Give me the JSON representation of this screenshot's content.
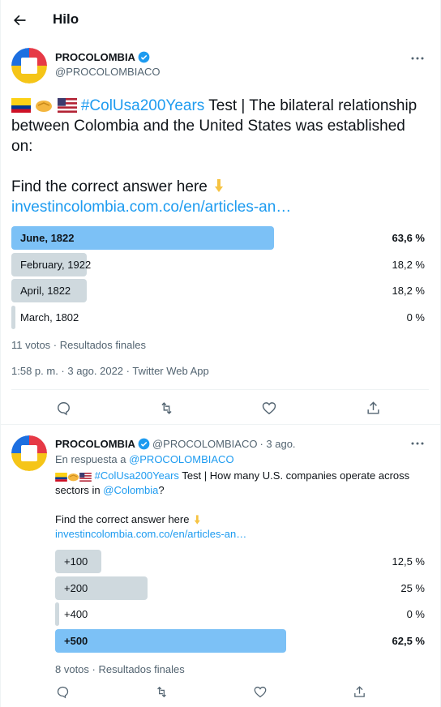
{
  "header": {
    "title": "Hilo",
    "back_icon": "arrow-left-icon"
  },
  "colors": {
    "accent": "#1d9bf0",
    "poll_winner": "#7cc1f6",
    "poll_other": "#cfd9de",
    "muted": "#536471",
    "verified": "#1d9bf0"
  },
  "tweet1": {
    "name": "PROCOLOMBIA",
    "handle": "@PROCOLOMBIACO",
    "verified_icon": "verified-badge-icon",
    "more_icon": "more-horizontal-icon",
    "emojis": [
      "colombia-flag-icon",
      "handshake-icon",
      "usa-flag-icon"
    ],
    "hashtag": "#ColUsa200Years",
    "text_after_hashtag": " Test | The bilateral relationship between Colombia and the United States was established on:",
    "find_text": "Find the correct answer here",
    "pointing_icon": "pointing-down-icon",
    "link": "investincolombia.com.co/en/articles-an…",
    "poll": [
      {
        "label": "June, 1822",
        "percent_text": "63,6 %",
        "value": 63.6,
        "winner": true
      },
      {
        "label": "February, 1922",
        "percent_text": "18,2 %",
        "value": 18.2,
        "winner": false
      },
      {
        "label": "April, 1822",
        "percent_text": "18,2 %",
        "value": 18.2,
        "winner": false
      },
      {
        "label": "March, 1802",
        "percent_text": "0 %",
        "value": 0,
        "winner": false
      }
    ],
    "votes": "11 votos · Resultados finales",
    "timestamp": "1:58 p. m. · 3 ago. 2022 · Twitter Web App",
    "actions": [
      "reply-icon",
      "retweet-icon",
      "like-icon",
      "share-icon"
    ]
  },
  "tweet2": {
    "name": "PROCOLOMBIA",
    "handle": "@PROCOLOMBIACO",
    "date": "· 3 ago.",
    "verified_icon": "verified-badge-icon",
    "more_icon": "more-horizontal-icon",
    "reply_prefix": "En respuesta a ",
    "reply_to": "@PROCOLOMBIACO",
    "emojis": [
      "colombia-flag-icon",
      "handshake-icon",
      "usa-flag-icon"
    ],
    "hashtag": "#ColUsa200Years",
    "text_part1": " Test | How many U.S. companies operate across sectors in ",
    "mention": "@Colombia",
    "text_part2": "?",
    "find_text": "Find the correct answer here",
    "pointing_icon": "pointing-down-icon",
    "link": "investincolombia.com.co/en/articles-an…",
    "poll": [
      {
        "label": "+100",
        "percent_text": "12,5 %",
        "value": 12.5,
        "winner": false
      },
      {
        "label": "+200",
        "percent_text": "25 %",
        "value": 25,
        "winner": false
      },
      {
        "label": "+400",
        "percent_text": "0 %",
        "value": 0,
        "winner": false
      },
      {
        "label": "+500",
        "percent_text": "62,5 %",
        "value": 62.5,
        "winner": true
      }
    ],
    "votes": "8 votos · Resultados finales",
    "actions": [
      "reply-icon",
      "retweet-icon",
      "like-icon",
      "share-icon"
    ]
  }
}
